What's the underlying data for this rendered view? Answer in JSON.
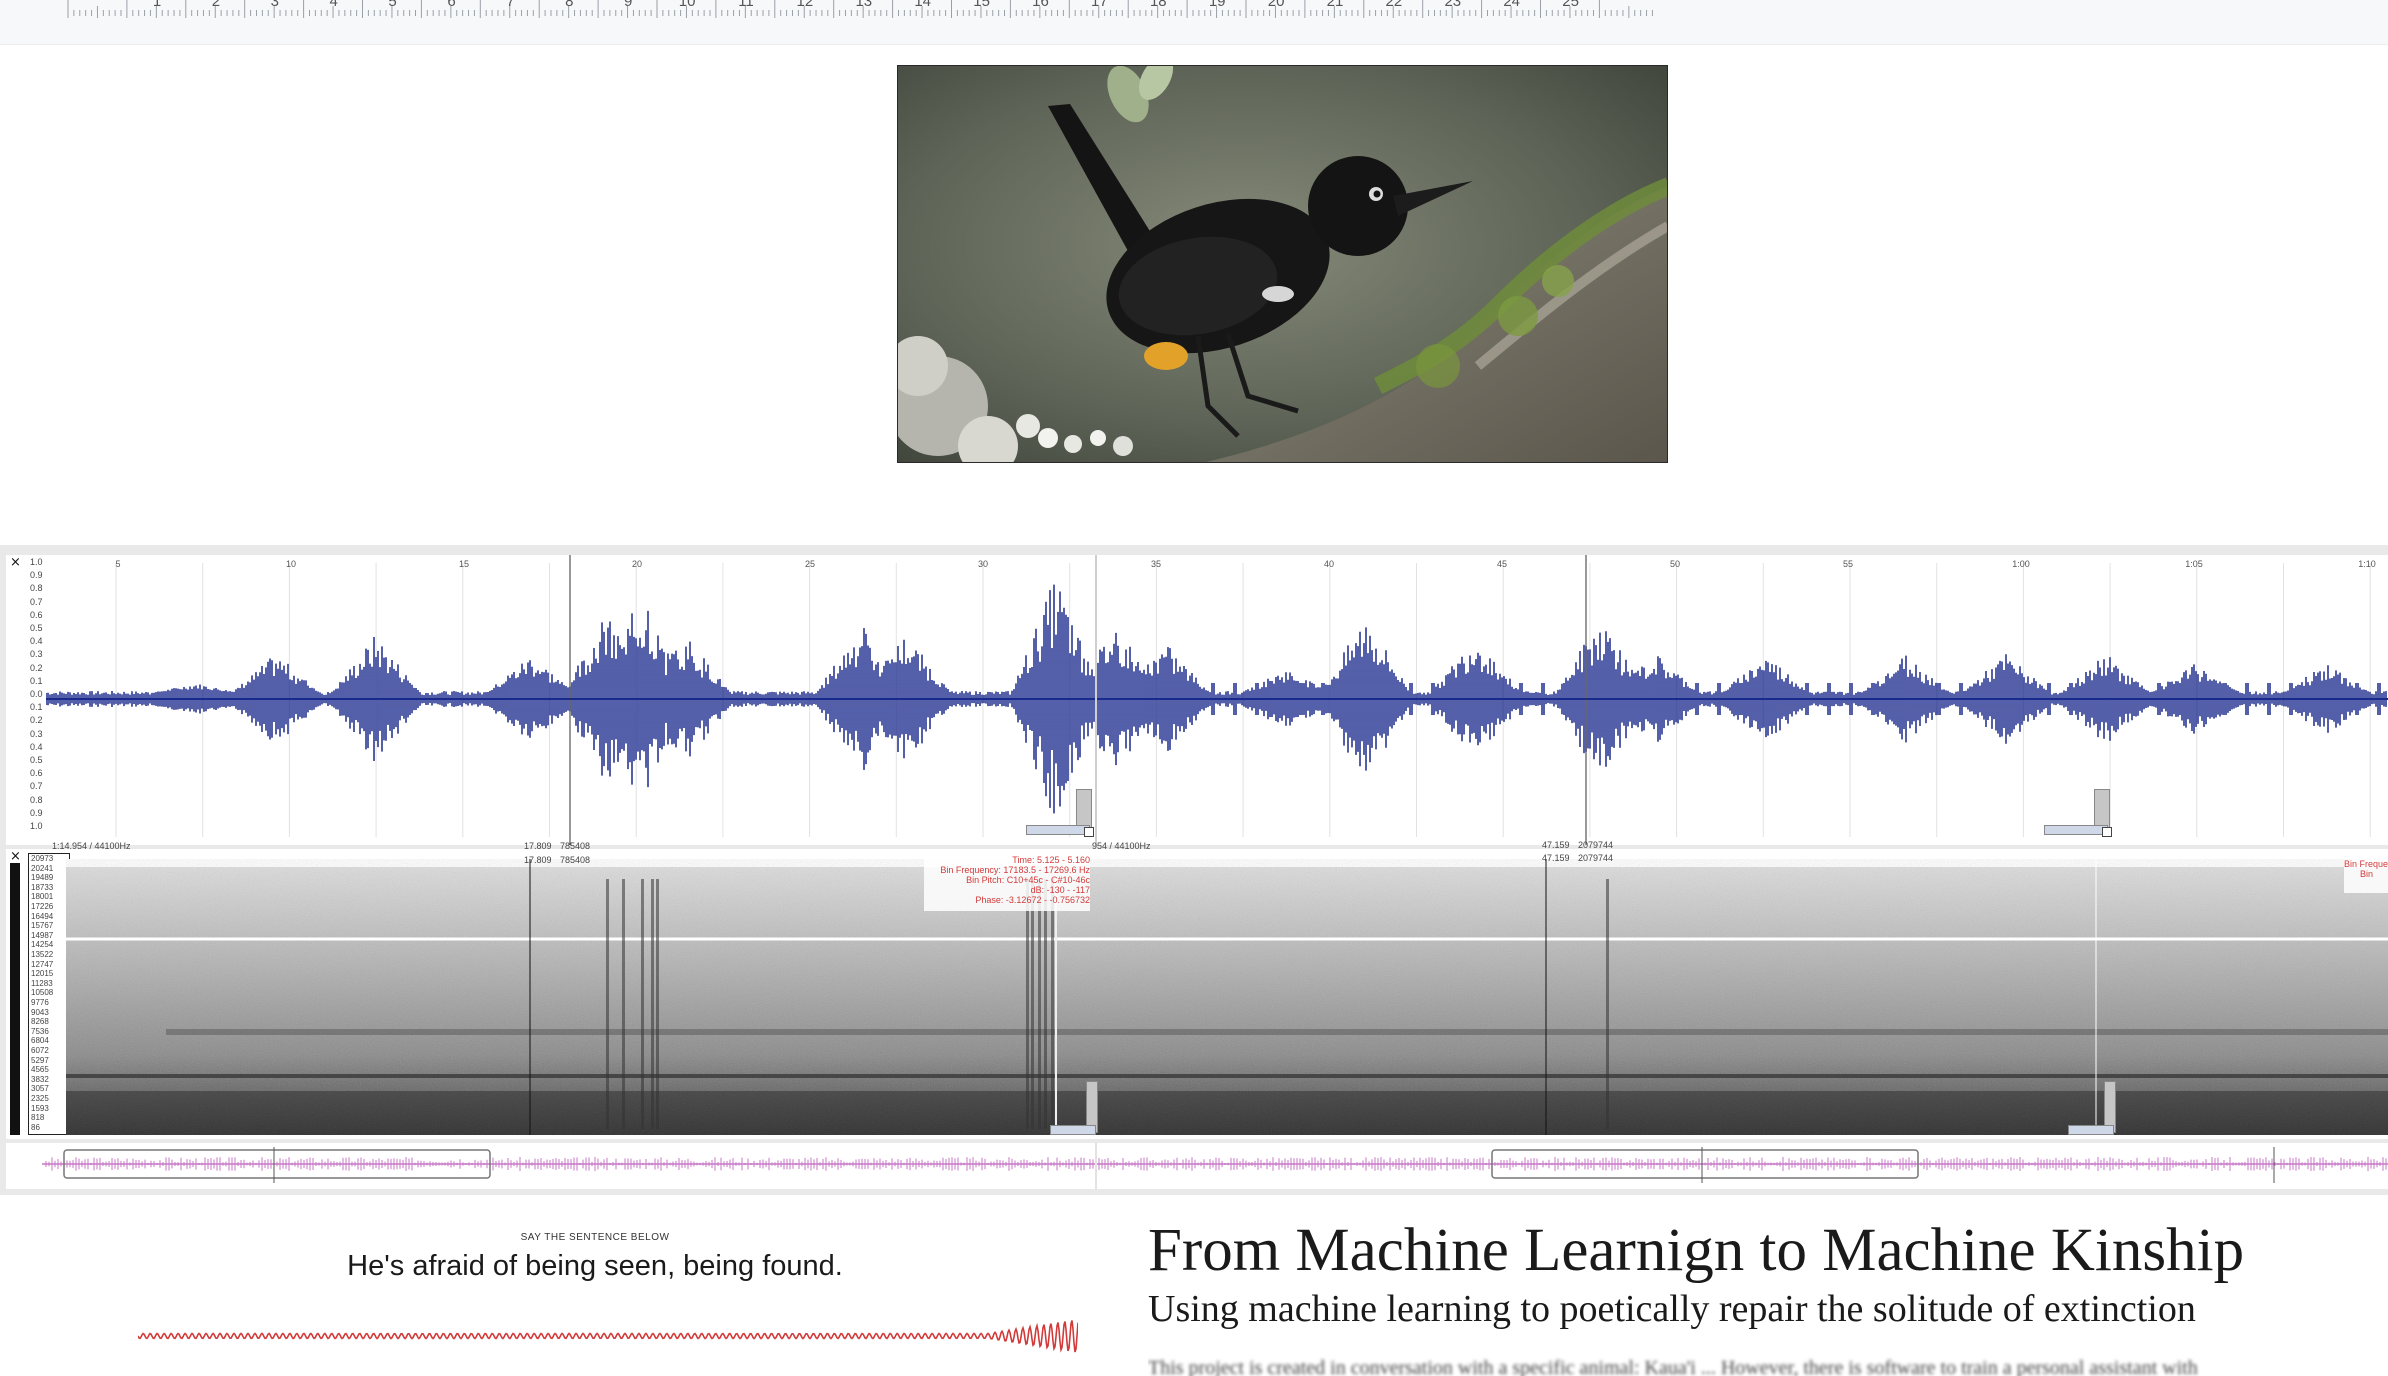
{
  "ruler": {
    "labels": [
      "1",
      "2",
      "3",
      "4",
      "5",
      "6",
      "7",
      "8",
      "9",
      "10",
      "11",
      "12",
      "13",
      "14",
      "15",
      "16",
      "17",
      "18",
      "19",
      "20",
      "21",
      "22",
      "23",
      "24",
      "25"
    ]
  },
  "image": {
    "subject": "black bird perched on a mossy branch"
  },
  "audio_editor": {
    "waveform": {
      "close_glyph": "×",
      "y_scale": [
        "1.0",
        "0.9",
        "0.8",
        "0.7",
        "0.6",
        "0.5",
        "0.4",
        "0.3",
        "0.2",
        "0.1",
        "0.0",
        "0.1",
        "0.2",
        "0.3",
        "0.4",
        "0.5",
        "0.6",
        "0.7",
        "0.8",
        "0.9",
        "1.0"
      ],
      "time_ticks": [
        "5",
        "10",
        "15",
        "20",
        "25",
        "30",
        "35",
        "40",
        "45",
        "50",
        "55",
        "1:00",
        "1:05",
        "1:10"
      ],
      "status_left": "1:14.954 / 44100Hz",
      "status_mid": "954 / 44100Hz",
      "cursor1_time": "17.809",
      "cursor1_sample": "785408",
      "cursor2_time": "47.159",
      "cursor2_sample": "2079744",
      "color": "#1b2a8c"
    },
    "spectrogram": {
      "close_glyph": "×",
      "freq_scale": [
        "20973",
        "20241",
        "19489",
        "18733",
        "18001",
        "17226",
        "16494",
        "15767",
        "14987",
        "14254",
        "13522",
        "12747",
        "12015",
        "11283",
        "10508",
        "9776",
        "9043",
        "8268",
        "7536",
        "6804",
        "6072",
        "5297",
        "4565",
        "3832",
        "3057",
        "2325",
        "1593",
        "818",
        "86"
      ],
      "cursor1_time": "17.809",
      "cursor1_sample": "785408",
      "cursor2_time": "47.159",
      "cursor2_sample": "2079744",
      "tooltip": {
        "time": "Time: 5.125 - 5.160",
        "bin_frequency": "Bin Frequency: 17183.5 - 17269.6 Hz",
        "bin_pitch": "Bin Pitch: C10+45c - C#10-46c",
        "db": "dB: -130 - -117",
        "phase": "Phase: -3.12672 - -0.756732"
      },
      "tooltip_right_1": "Bin Freque",
      "tooltip_right_2": "Bin"
    },
    "overview": {
      "color": "#c777c7"
    }
  },
  "voice_prompt": {
    "caption": "SAY THE SENTENCE BELOW",
    "sentence": "He's afraid of being seen, being found.",
    "wave_color": "#d23a3a"
  },
  "article": {
    "title": "From Machine Learnign to Machine Kinship",
    "subtitle": "Using machine learning to poetically repair the solitude of extinction",
    "body_preview": "This project is created in conversation with a specific animal: Kaua'i ... However, there is software to train a personal assistant with"
  }
}
